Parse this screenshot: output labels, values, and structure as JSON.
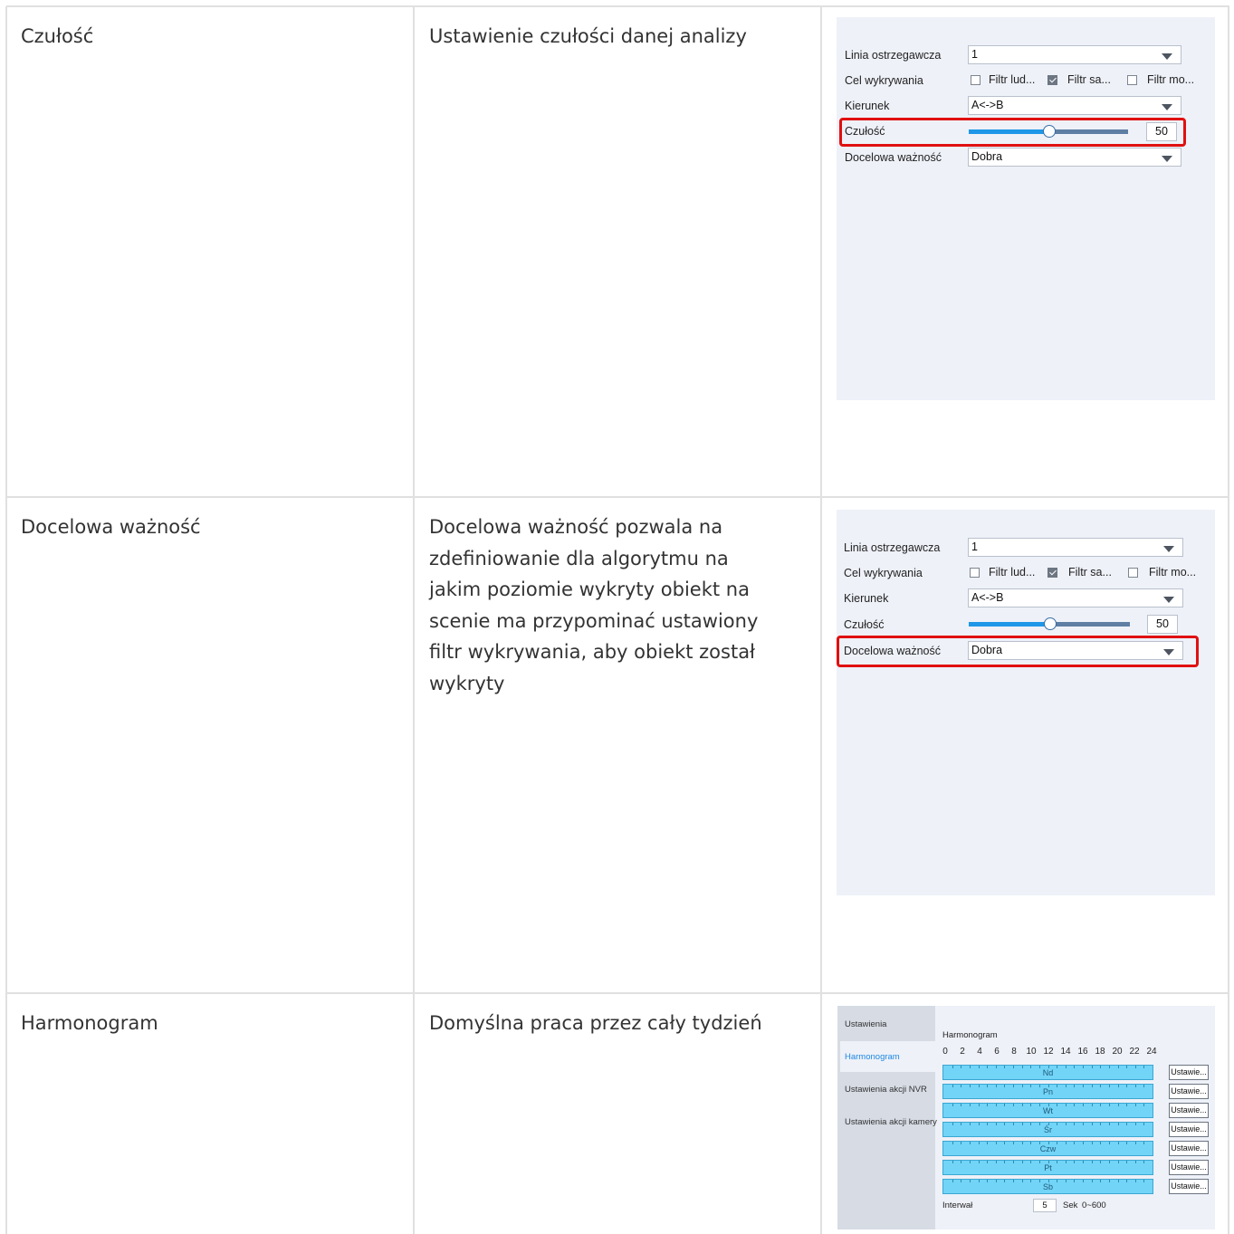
{
  "rows": [
    {
      "name": "Czułość",
      "description": "Ustawienie czułości danej analizy",
      "panel": {
        "linia_label": "Linia ostrzegawcza",
        "linia_value": "1",
        "cel_label": "Cel wykrywania",
        "filters": [
          {
            "label": "Filtr lud...",
            "checked": false
          },
          {
            "label": "Filtr sa...",
            "checked": true
          },
          {
            "label": "Filtr mo...",
            "checked": false
          }
        ],
        "kierunek_label": "Kierunek",
        "kierunek_value": "A<->B",
        "czulosc_label": "Czułość",
        "czulosc_value": "50",
        "czulosc_level": 0.5,
        "waznosc_label": "Docelowa ważność",
        "waznosc_value": "Dobra",
        "highlight": "czulosc",
        "highlight_color": "#e01010"
      }
    },
    {
      "name": "Docelowa ważność",
      "description_lines": [
        "Docelowa ważność pozwala na",
        "zdefiniowanie dla algorytmu na",
        "jakim poziomie wykryty obiekt na",
        "scenie ma przypominać ustawiony",
        "filtr wykrywania, aby obiekt został",
        "wykryty"
      ],
      "panel": {
        "linia_label": "Linia ostrzegawcza",
        "linia_value": "1",
        "cel_label": "Cel wykrywania",
        "filters": [
          {
            "label": "Filtr lud...",
            "checked": false
          },
          {
            "label": "Filtr sa...",
            "checked": true
          },
          {
            "label": "Filtr mo...",
            "checked": false
          }
        ],
        "kierunek_label": "Kierunek",
        "kierunek_value": "A<->B",
        "czulosc_label": "Czułość",
        "czulosc_value": "50",
        "czulosc_level": 0.5,
        "waznosc_label": "Docelowa ważność",
        "waznosc_value": "Dobra",
        "highlight": "waznosc",
        "highlight_color": "#e01010"
      }
    },
    {
      "name": "Harmonogram",
      "description": "Domyślna praca przez cały tydzień",
      "schedule": {
        "tabs": [
          "Ustawienia",
          "Harmonogram",
          "Ustawienia akcji NVR",
          "Ustawienia akcji kamery"
        ],
        "active_tab": "Harmonogram",
        "title": "Harmonogram",
        "hours": [
          "0",
          "2",
          "4",
          "6",
          "8",
          "10",
          "12",
          "14",
          "16",
          "18",
          "20",
          "22",
          "24"
        ],
        "days": [
          "Nd",
          "Pn",
          "Wt",
          "Śr",
          "Czw",
          "Pt",
          "Sb"
        ],
        "button_label": "Ustawie...",
        "interval_label": "Interwał",
        "interval_value": "5",
        "interval_unit": "Sek",
        "interval_range": "0~600",
        "bar_color": "#72d4f7",
        "active_tab_color": "#1e88e5"
      }
    }
  ]
}
